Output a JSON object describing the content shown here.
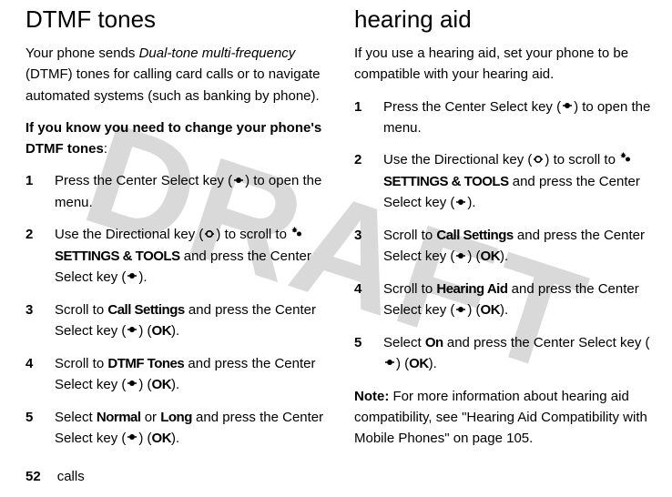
{
  "watermark": "DRAFT",
  "left": {
    "heading": "DTMF tones",
    "intro_pre": "Your phone sends ",
    "intro_italic": "Dual-tone multi-frequency",
    "intro_post": " (DTMF) tones for calling card calls or to navigate automated systems (such as banking by phone).",
    "bold_line": "If you know you need to change your phone's DTMF tones",
    "bold_colon": ":",
    "steps": [
      {
        "pre": "Press the Center Select key (",
        "icon": "dot",
        "post": ") to open the menu."
      },
      {
        "pre": "Use the Directional key (",
        "icon": "dir",
        "t2": ") to scroll to ",
        "gear": true,
        "menu": "SETTINGS & TOOLS",
        "t3": " and press the Center Select key (",
        "icon2": "dot",
        "t4": ")."
      },
      {
        "pre": "Scroll to ",
        "menu": "Call Settings",
        "t2": " and press the Center Select key (",
        "icon": "dot",
        "t3": ") (",
        "ok": "OK",
        "t4": ")."
      },
      {
        "pre": "Scroll to ",
        "menu": "DTMF Tones",
        "t2": " and press the Center Select key (",
        "icon": "dot",
        "t3": ") (",
        "ok": "OK",
        "t4": ")."
      },
      {
        "pre": "Select ",
        "menu": "Normal",
        "t2": " or ",
        "menu2": "Long",
        "t3": " and press the Center Select key (",
        "icon": "dot",
        "t4": ") (",
        "ok": "OK",
        "t5": ")."
      }
    ]
  },
  "right": {
    "heading": "hearing aid",
    "intro": "If you use a hearing aid, set your phone to be compatible with your hearing aid.",
    "steps": [
      {
        "pre": "Press the Center Select key (",
        "icon": "dot",
        "post": ") to open the menu."
      },
      {
        "pre": "Use the Directional key (",
        "icon": "dir",
        "t2": ") to scroll to ",
        "gear": true,
        "menu": "SETTINGS & TOOLS",
        "t3": " and press the Center Select key (",
        "icon2": "dot",
        "t4": ")."
      },
      {
        "pre": "Scroll to ",
        "menu": "Call Settings",
        "t2": " and press the Center Select key (",
        "icon": "dot",
        "t3": ") (",
        "ok": "OK",
        "t4": ")."
      },
      {
        "pre": "Scroll to ",
        "menu": "Hearing Aid",
        "t2": " and press the Center Select key (",
        "icon": "dot",
        "t3": ") (",
        "ok": "OK",
        "t4": ")."
      },
      {
        "pre": "Select ",
        "menu": "On",
        "t2": " and press the Center Select key (",
        "icon": "dot",
        "t3": ") (",
        "ok": "OK",
        "t4": ")."
      }
    ],
    "note_label": "Note:",
    "note_body": " For more information about hearing aid compatibility, see \"Hearing Aid Compatibility with Mobile Phones\" on page 105."
  },
  "footer": {
    "page": "52",
    "section": "calls"
  }
}
